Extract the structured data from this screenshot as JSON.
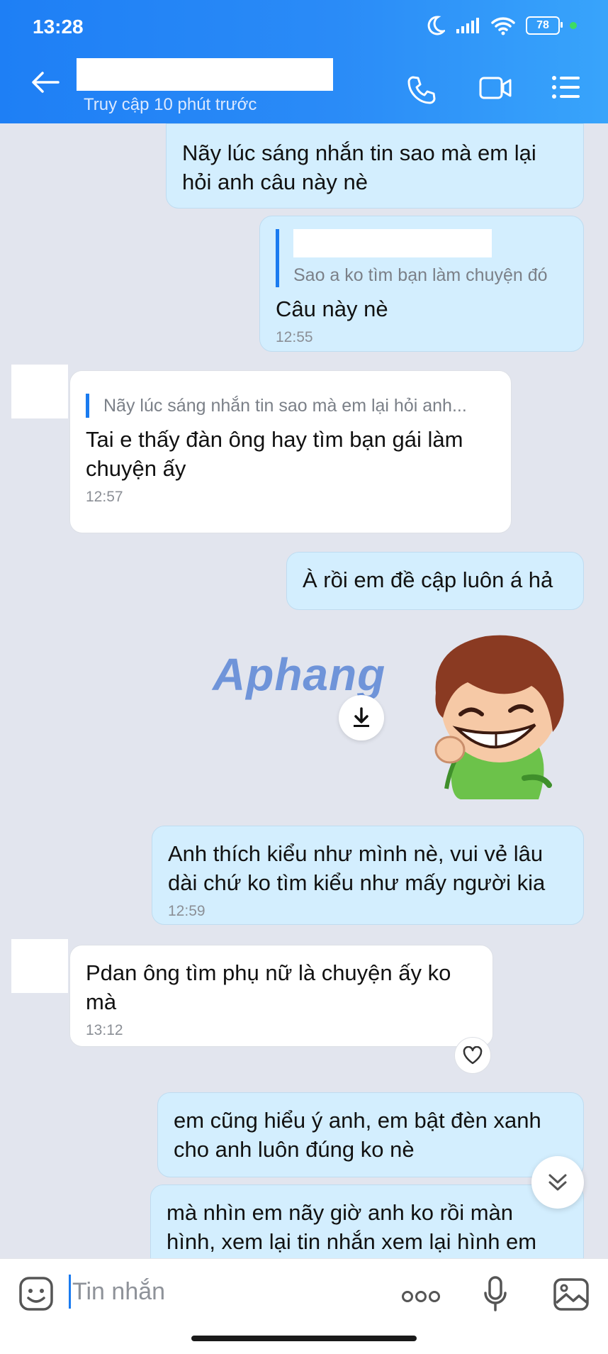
{
  "status_bar": {
    "time": "13:28",
    "battery": "78"
  },
  "header": {
    "subtitle": "Truy cập 10 phút trước"
  },
  "messages": [
    {
      "text": "Nãy lúc sáng nhắn tin sao mà em lại hỏi anh câu này nè"
    },
    {
      "quote": "Sao a ko tìm bạn làm chuyện đó",
      "text": "Câu này nè",
      "time": "12:55"
    },
    {
      "quote": "Nãy lúc sáng nhắn tin sao mà em lại hỏi anh...",
      "text": "Tai e thấy đàn ông hay tìm bạn gái làm chuyện ấy",
      "time": "12:57"
    },
    {
      "text": "À rồi em đề cập luôn á hả"
    },
    {
      "text": "Anh thích kiểu như mình nè, vui vẻ lâu dài chứ ko tìm kiểu như mấy người kia",
      "time": "12:59"
    },
    {
      "text": "Pdan ông tìm phụ nữ là chuyện ấy ko mà",
      "time": "13:12"
    },
    {
      "text": "em cũng hiểu ý anh, em bật đèn xanh cho anh luôn đúng ko nè"
    },
    {
      "text": "mà nhìn em nãy giờ anh ko rồi màn hình, xem lại tin nhắn xem lại hình em"
    }
  ],
  "watermark": "Aphang",
  "input": {
    "placeholder": "Tin nhắn"
  },
  "colors": {
    "header_start": "#1e7ff5",
    "header_end": "#38a4fb",
    "outgoing_bubble": "#d3eefe",
    "incoming_bubble": "#ffffff",
    "chat_background": "#e2e5ee",
    "accent": "#1a7bf0"
  }
}
